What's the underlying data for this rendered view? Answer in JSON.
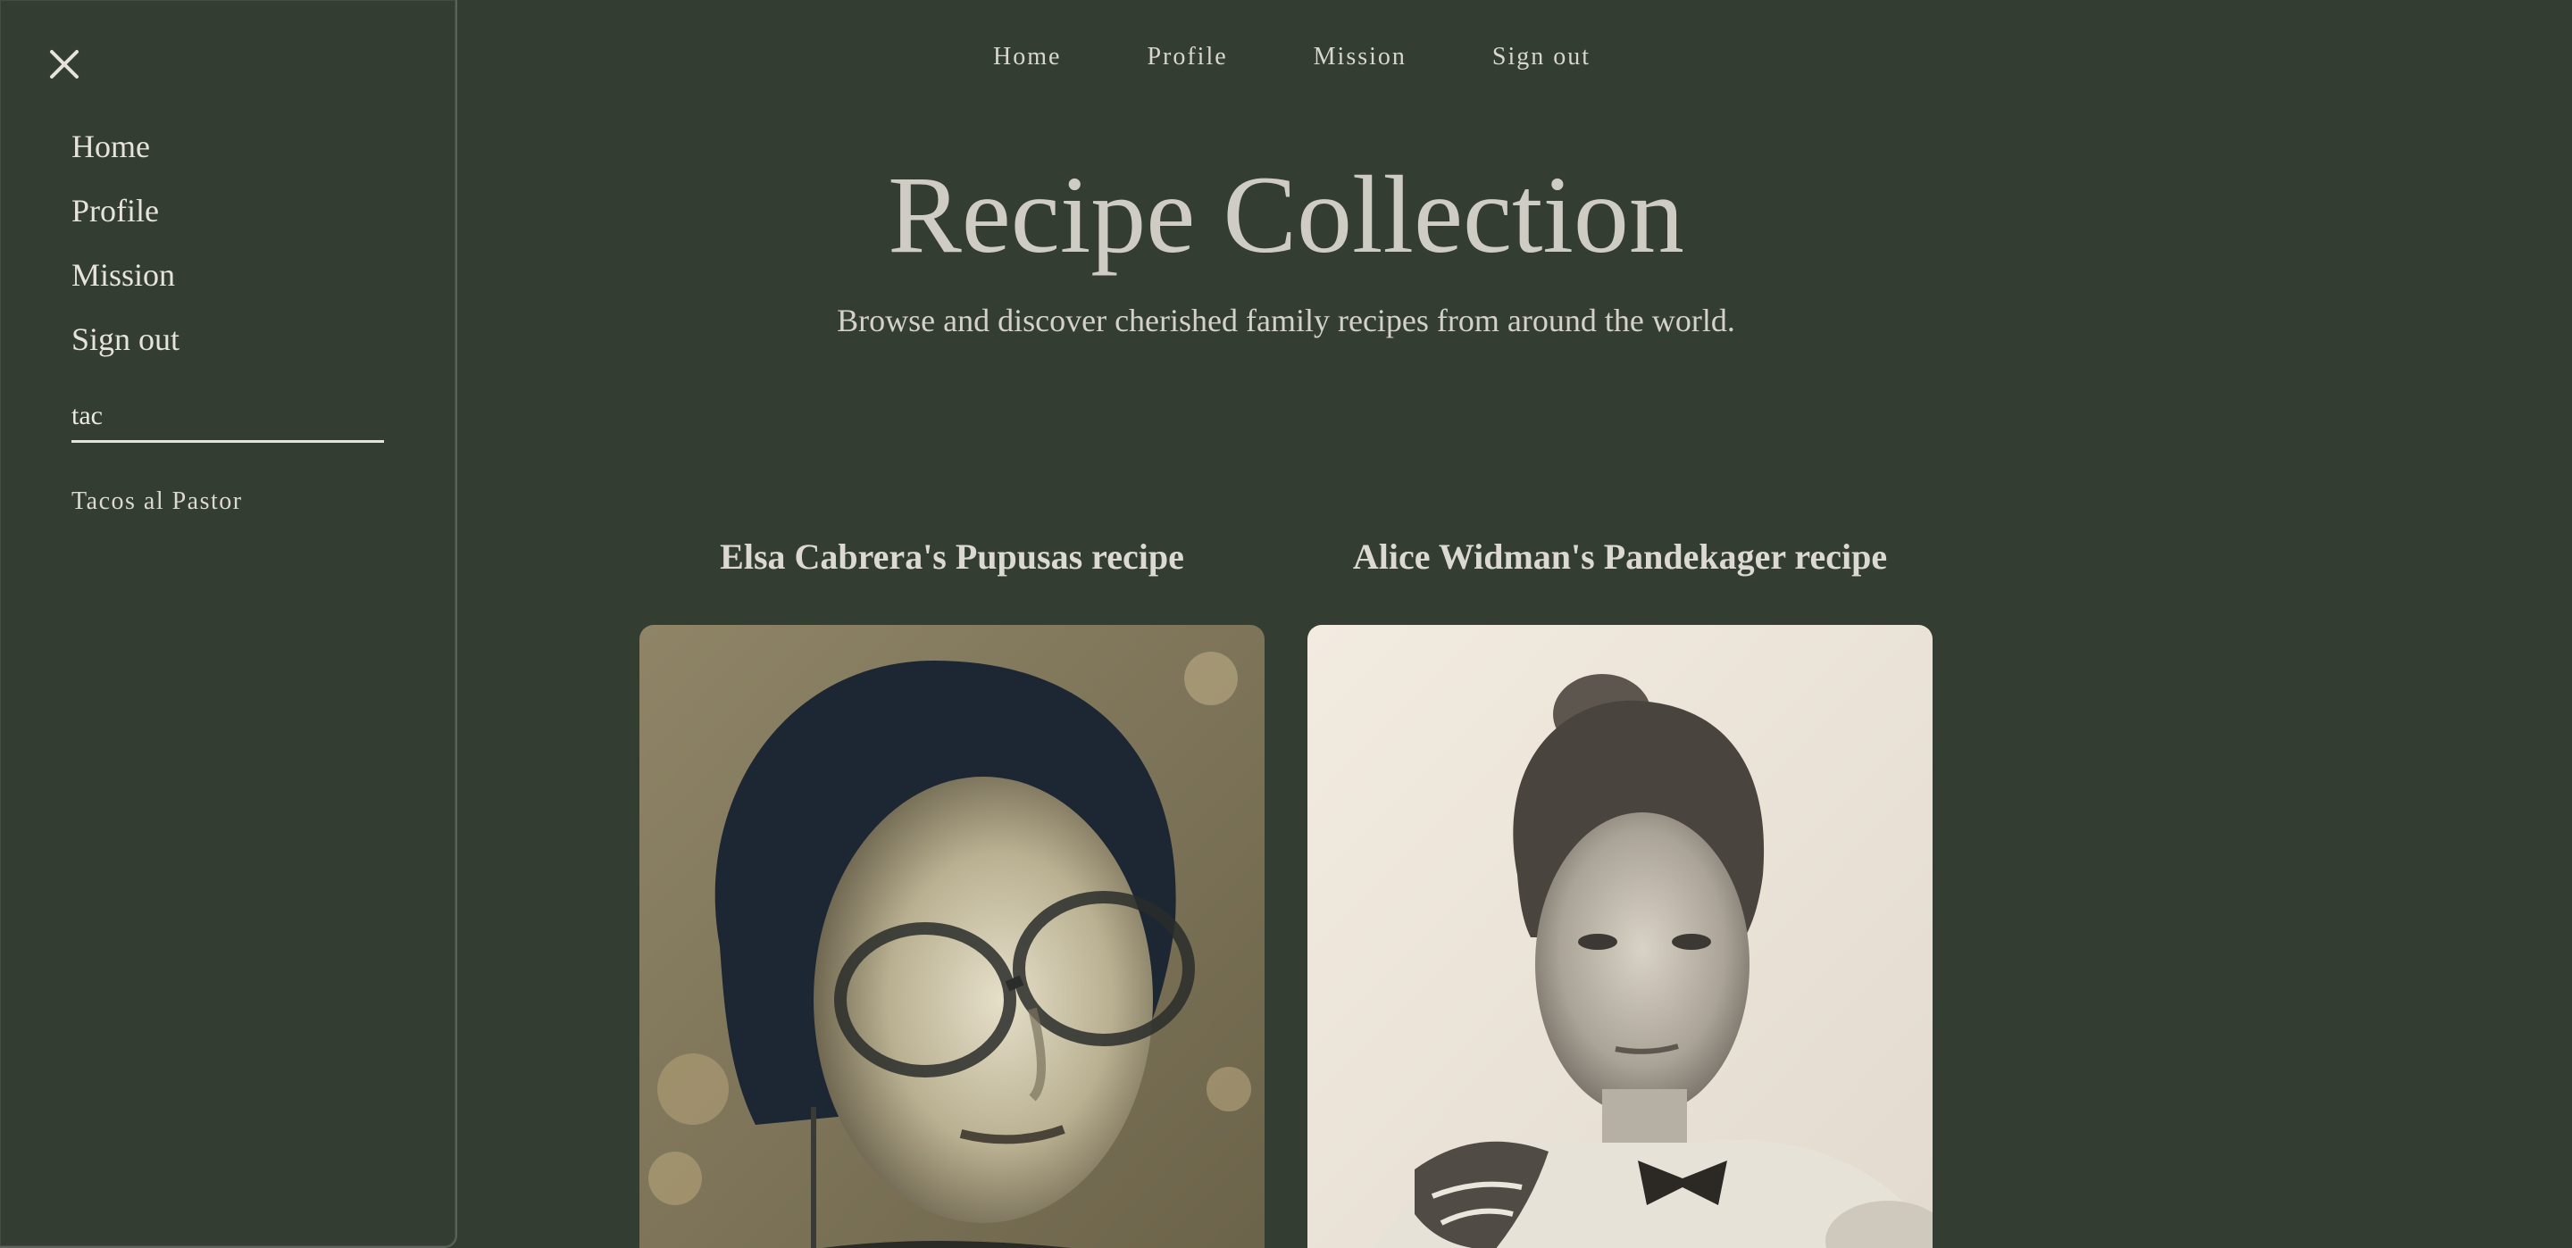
{
  "sidebar": {
    "items": [
      {
        "label": "Home"
      },
      {
        "label": "Profile"
      },
      {
        "label": "Mission"
      },
      {
        "label": "Sign out"
      }
    ],
    "search": {
      "value": "tac"
    },
    "results": [
      {
        "label": "Tacos al Pastor"
      }
    ]
  },
  "top_nav": {
    "items": [
      {
        "label": "Home"
      },
      {
        "label": "Profile"
      },
      {
        "label": "Mission"
      },
      {
        "label": "Sign out"
      }
    ]
  },
  "page": {
    "title": "Recipe Collection",
    "subtitle": "Browse and discover cherished family recipes from around the world."
  },
  "recipes": [
    {
      "title": "Elsa Cabrera's Pupusas recipe"
    },
    {
      "title": "Alice Widman's Pandekager recipe"
    }
  ],
  "colors": {
    "background": "#333d32",
    "text": "#d9d6ce"
  }
}
